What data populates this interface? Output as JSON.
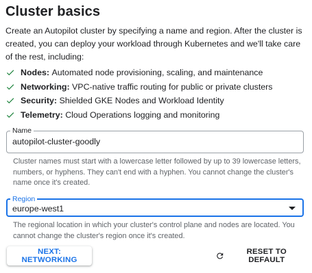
{
  "header": {
    "title": "Cluster basics"
  },
  "intro": "Create an Autopilot cluster by specifying a name and region. After the cluster is created, you can deploy your workload through Kubernetes and we'll take care of the rest, including:",
  "features": [
    {
      "label": "Nodes:",
      "text": "Automated node provisioning, scaling, and maintenance"
    },
    {
      "label": "Networking:",
      "text": "VPC-native traffic routing for public or private clusters"
    },
    {
      "label": "Security:",
      "text": "Shielded GKE Nodes and Workload Identity"
    },
    {
      "label": "Telemetry:",
      "text": "Cloud Operations logging and monitoring"
    }
  ],
  "name_field": {
    "label": "Name",
    "value": "autopilot-cluster-goodly",
    "help": "Cluster names must start with a lowercase letter followed by up to 39 lowercase letters, numbers, or hyphens. They can't end with a hyphen. You cannot change the cluster's name once it's created."
  },
  "region_field": {
    "label": "Region",
    "value": "europe-west1",
    "help": "The regional location in which your cluster's control plane and nodes are located. You cannot change the cluster's region once it's created."
  },
  "actions": {
    "next_label": "NEXT: NETWORKING",
    "reset_label": "RESET TO DEFAULT"
  },
  "colors": {
    "accent": "#1a73e8",
    "check": "#188038",
    "help_text": "#5f6368"
  },
  "icons": {
    "feature": "check-icon",
    "dropdown": "arrow-drop-down-icon",
    "reset": "refresh-icon"
  }
}
